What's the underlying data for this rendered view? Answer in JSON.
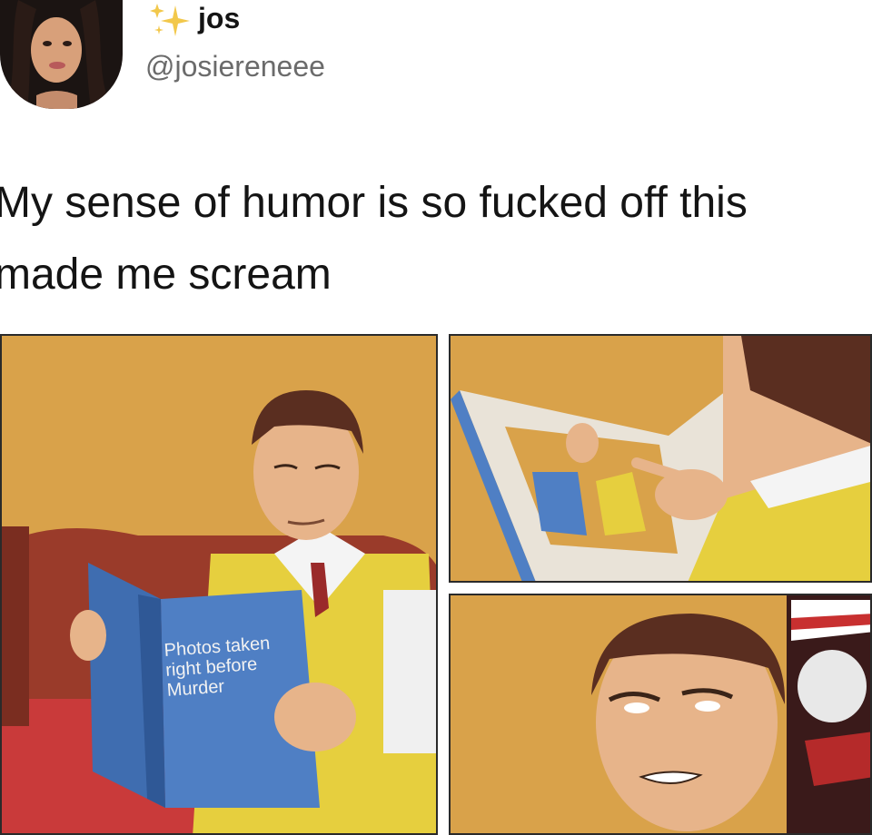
{
  "tweet": {
    "display_name": "jos",
    "handle": "@josiereneee",
    "text": "My sense of humor is so fucked off this\nmade me scream",
    "name_emoji_icon": "sparkles-icon"
  },
  "comic": {
    "book_title": "Photos taken\nright before\nMurder"
  },
  "colors": {
    "wall": "#d9a24a",
    "book": "#4f7fc4",
    "vest": "#e6cf3e",
    "hair": "#5a2e20",
    "skin": "#e7b48a"
  }
}
